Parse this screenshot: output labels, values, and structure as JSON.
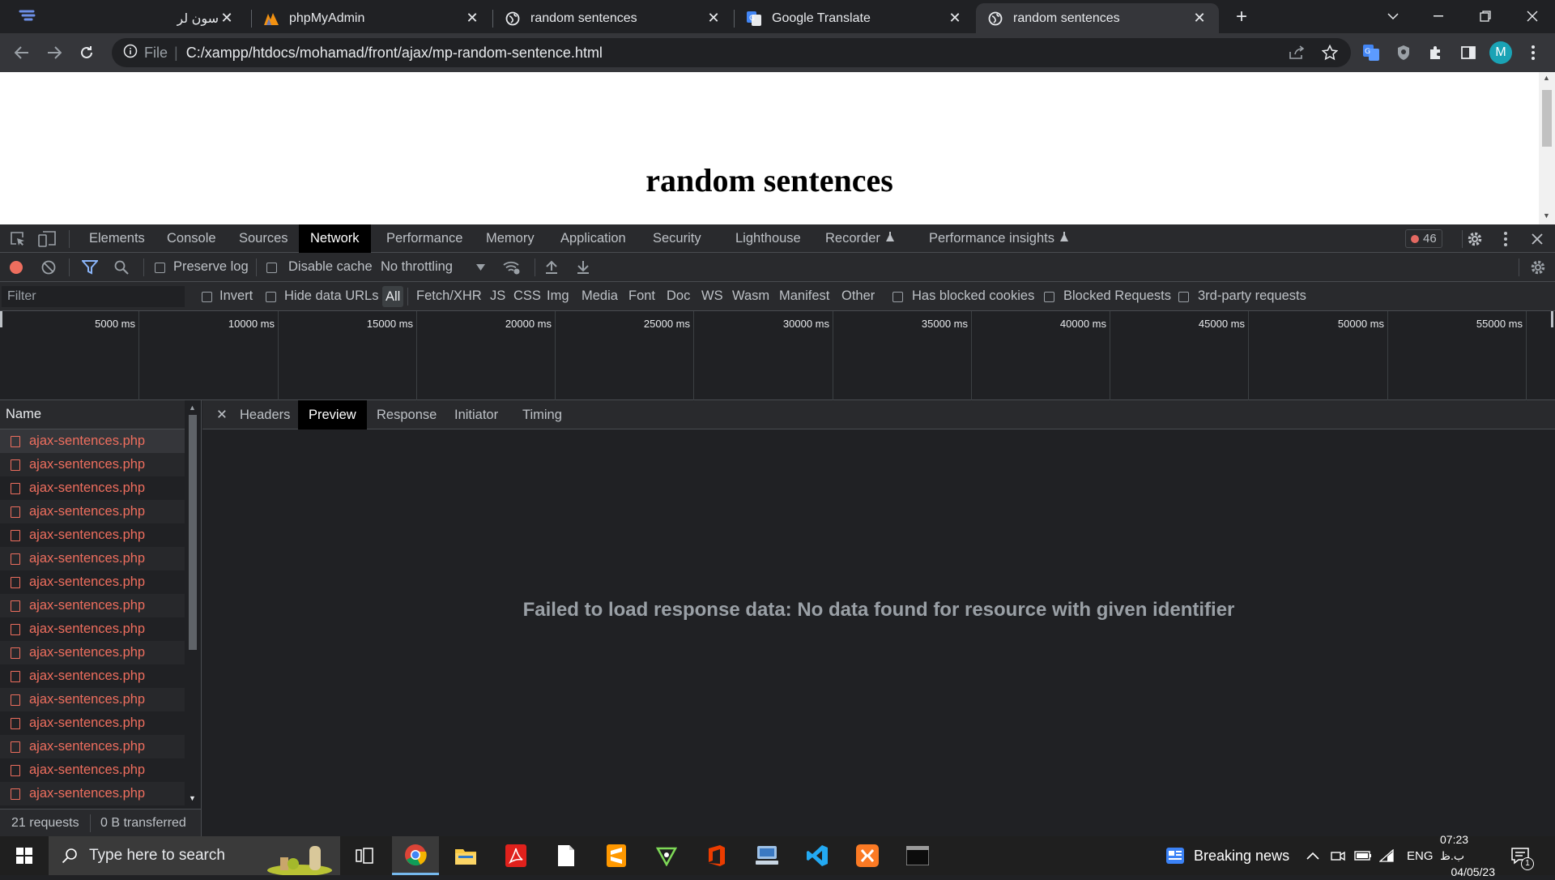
{
  "browser": {
    "tabs": [
      {
        "title": "سون لرن",
        "favicon": "layers-icon",
        "active": false
      },
      {
        "title": "phpMyAdmin",
        "favicon": "phpmyadmin-icon",
        "active": false
      },
      {
        "title": "random sentences",
        "favicon": "globe-icon",
        "active": false
      },
      {
        "title": "Google Translate",
        "favicon": "google-translate-icon",
        "active": false
      },
      {
        "title": "random sentences",
        "favicon": "globe-icon",
        "active": true
      }
    ],
    "new_tab_label": "+",
    "address": {
      "scheme_label": "File",
      "url": "C:/xampp/htdocs/mohamad/front/ajax/mp-random-sentence.html"
    },
    "profile_initial": "M"
  },
  "page": {
    "heading": "random sentences"
  },
  "devtools": {
    "tabs": [
      "Elements",
      "Console",
      "Sources",
      "Network",
      "Performance",
      "Memory",
      "Application",
      "Security",
      "Lighthouse",
      "Recorder",
      "Performance insights"
    ],
    "active_tab": "Network",
    "error_count": "46",
    "toolbar": {
      "preserve_log": "Preserve log",
      "disable_cache": "Disable cache",
      "throttling": "No throttling"
    },
    "filterbar": {
      "filter_placeholder": "Filter",
      "invert": "Invert",
      "hide_data_urls": "Hide data URLs",
      "types": [
        "All",
        "Fetch/XHR",
        "JS",
        "CSS",
        "Img",
        "Media",
        "Font",
        "Doc",
        "WS",
        "Wasm",
        "Manifest",
        "Other"
      ],
      "active_type": "All",
      "has_blocked_cookies": "Has blocked cookies",
      "blocked_requests": "Blocked Requests",
      "third_party": "3rd-party requests"
    },
    "overview_ticks": [
      "5000 ms",
      "10000 ms",
      "15000 ms",
      "20000 ms",
      "25000 ms",
      "30000 ms",
      "35000 ms",
      "40000 ms",
      "45000 ms",
      "50000 ms",
      "55000 ms"
    ],
    "request_list": {
      "column_name": "Name",
      "rows": [
        "ajax-sentences.php",
        "ajax-sentences.php",
        "ajax-sentences.php",
        "ajax-sentences.php",
        "ajax-sentences.php",
        "ajax-sentences.php",
        "ajax-sentences.php",
        "ajax-sentences.php",
        "ajax-sentences.php",
        "ajax-sentences.php",
        "ajax-sentences.php",
        "ajax-sentences.php",
        "ajax-sentences.php",
        "ajax-sentences.php",
        "ajax-sentences.php",
        "ajax-sentences.php"
      ]
    },
    "preview": {
      "tabs": [
        "Headers",
        "Preview",
        "Response",
        "Initiator",
        "Timing"
      ],
      "active_tab": "Preview",
      "message": "Failed to load response data: No data found for resource with given identifier"
    },
    "status": {
      "requests": "21 requests",
      "transferred": "0 B transferred"
    }
  },
  "taskbar": {
    "search_placeholder": "Type here to search",
    "news": "Breaking news",
    "language": "ENG",
    "time": "07:23 ب.ظ",
    "date": "04/05/23",
    "notification_count": "1"
  }
}
